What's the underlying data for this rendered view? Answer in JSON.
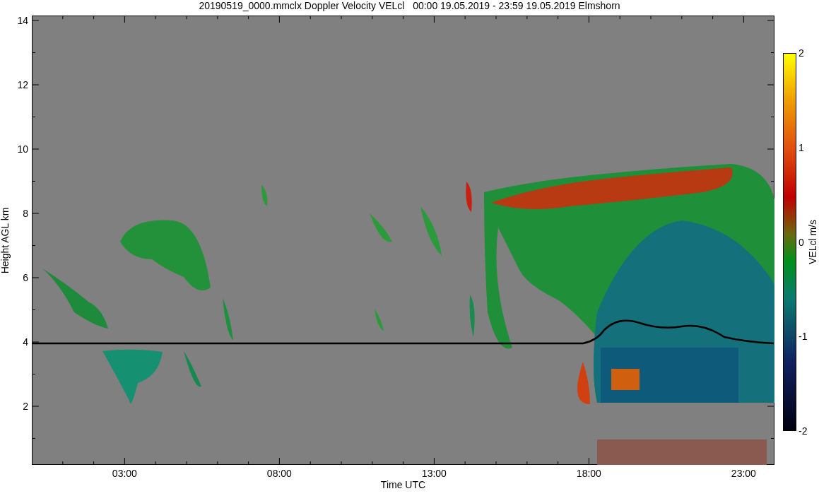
{
  "title": "20190519_0000.mmclx Doppler Velocity VELcl   00:00 19.05.2019 - 23:59 19.05.2019 Elmshorn",
  "y_axis": {
    "label": "Height AGL km",
    "ticks": [
      "14",
      "12",
      "10",
      "8",
      "6",
      "4",
      "2"
    ]
  },
  "x_axis": {
    "label": "Time UTC",
    "ticks": [
      "03:00",
      "08:00",
      "13:00",
      "18:00",
      "23:00"
    ]
  },
  "colorbar": {
    "label": "VELcl m/s",
    "ticks": [
      "2",
      "1",
      "0",
      "-1",
      "-2"
    ]
  }
}
